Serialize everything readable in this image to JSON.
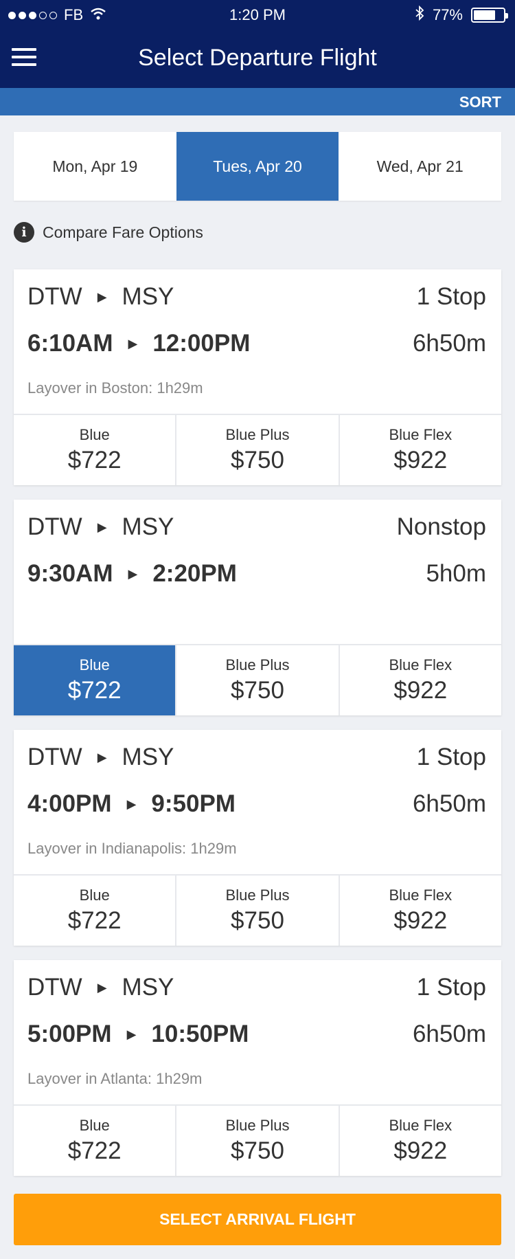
{
  "status_bar": {
    "carrier": "FB",
    "time": "1:20 PM",
    "battery": "77%",
    "battery_level": 0.77
  },
  "nav": {
    "title": "Select Departure Flight",
    "menu_icon": "hamburger-menu-icon"
  },
  "sort_label": "SORT",
  "date_tabs": [
    {
      "label": "Mon, Apr 19",
      "active": false
    },
    {
      "label": "Tues, Apr 20",
      "active": true
    },
    {
      "label": "Wed, Apr 21",
      "active": false
    }
  ],
  "compare_label": "Compare Fare Options",
  "flights": [
    {
      "origin": "DTW",
      "destination": "MSY",
      "stops": "1 Stop",
      "depart": "6:10AM",
      "arrive": "12:00PM",
      "duration": "6h50m",
      "layover": "Layover in Boston: 1h29m",
      "fares": [
        {
          "name": "Blue",
          "price": "$722"
        },
        {
          "name": "Blue Plus",
          "price": "$750"
        },
        {
          "name": "Blue Flex",
          "price": "$922"
        }
      ]
    },
    {
      "origin": "DTW",
      "destination": "MSY",
      "stops": "Nonstop",
      "depart": "9:30AM",
      "arrive": "2:20PM",
      "duration": "5h0m",
      "layover": "",
      "fares": [
        {
          "name": "Blue",
          "price": "$722",
          "selected": true
        },
        {
          "name": "Blue Plus",
          "price": "$750"
        },
        {
          "name": "Blue Flex",
          "price": "$922"
        }
      ]
    },
    {
      "origin": "DTW",
      "destination": "MSY",
      "stops": "1 Stop",
      "depart": "4:00PM",
      "arrive": "9:50PM",
      "duration": "6h50m",
      "layover": "Layover in Indianapolis: 1h29m",
      "fares": [
        {
          "name": "Blue",
          "price": "$722"
        },
        {
          "name": "Blue Plus",
          "price": "$750"
        },
        {
          "name": "Blue Flex",
          "price": "$922"
        }
      ]
    },
    {
      "origin": "DTW",
      "destination": "MSY",
      "stops": "1 Stop",
      "depart": "5:00PM",
      "arrive": "10:50PM",
      "duration": "6h50m",
      "layover": "Layover in Atlanta: 1h29m",
      "fares": [
        {
          "name": "Blue",
          "price": "$722"
        },
        {
          "name": "Blue Plus",
          "price": "$750"
        },
        {
          "name": "Blue Flex",
          "price": "$922"
        }
      ]
    }
  ],
  "cta_label": "SELECT ARRIVAL FLIGHT",
  "colors": {
    "nav_bg": "#0a1f63",
    "accent_blue": "#2f6db5",
    "cta_orange": "#ff9e0a",
    "page_bg": "#eef0f4"
  }
}
